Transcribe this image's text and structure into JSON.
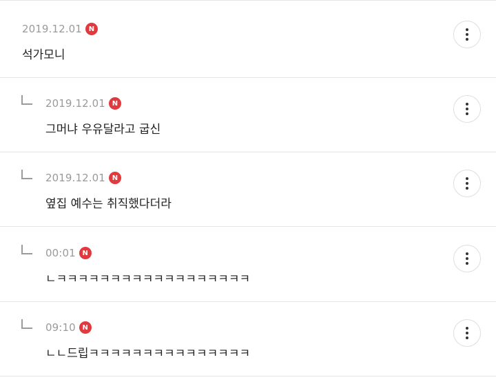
{
  "comments": [
    {
      "date": "2019.12.01",
      "badge": "N",
      "text": "석가모니",
      "is_reply": false
    },
    {
      "date": "2019.12.01",
      "badge": "N",
      "text": "그머냐 우유달라고 굽신",
      "is_reply": true
    },
    {
      "date": "2019.12.01",
      "badge": "N",
      "text": "옆집 예수는 취직했다더라",
      "is_reply": true
    },
    {
      "date": "00:01",
      "badge": "N",
      "text": "ㄴㅋㅋㅋㅋㅋㅋㅋㅋㅋㅋㅋㅋㅋㅋㅋㅋㅋㅋ",
      "is_reply": true
    },
    {
      "date": "09:10",
      "badge": "N",
      "text": "ㄴㄴ드립ㅋㅋㅋㅋㅋㅋㅋㅋㅋㅋㅋㅋㅋㅋㅋ",
      "is_reply": true
    }
  ],
  "icons": {
    "reply": "reply-arrow-icon",
    "more": "more-vertical-icon",
    "new": "new-badge"
  },
  "colors": {
    "badge": "#e0393e",
    "date": "#9a9a9a",
    "text": "#222222"
  }
}
